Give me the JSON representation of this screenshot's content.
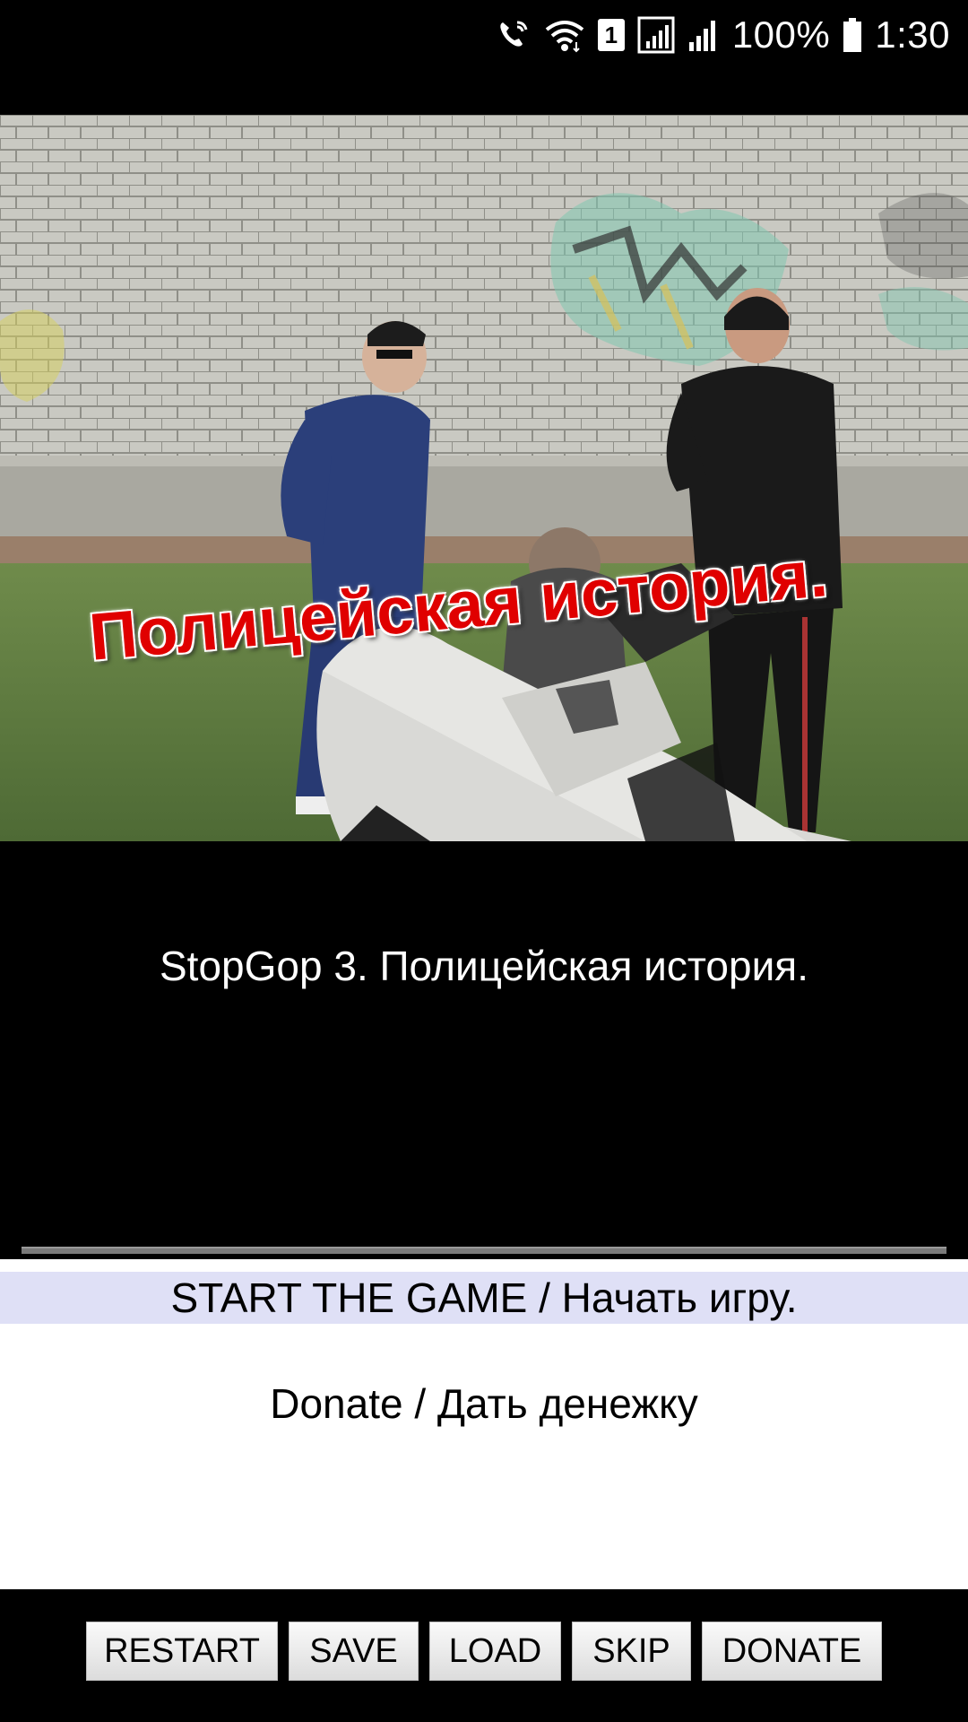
{
  "status_bar": {
    "icons": [
      "wifi-call-icon",
      "wifi-icon",
      "sim-1-icon",
      "signal-icon",
      "signal-2-icon",
      "battery-icon"
    ],
    "sim_label": "1",
    "battery": "100%",
    "time": "1:30"
  },
  "scene": {
    "caption": "Полицейская история."
  },
  "narration": {
    "text": "StopGop 3. Полицейская история."
  },
  "menu": {
    "start": "START THE GAME / Начать игру.",
    "donate": "Donate / Дать денежку"
  },
  "toolbar": {
    "restart": "RESTART",
    "save": "SAVE",
    "load": "LOAD",
    "skip": "SKIP",
    "donate": "DONATE"
  },
  "colors": {
    "menu_highlight": "#dfe0f6",
    "caption_red": "#e00000",
    "button_bg": "#e8e8e8"
  }
}
